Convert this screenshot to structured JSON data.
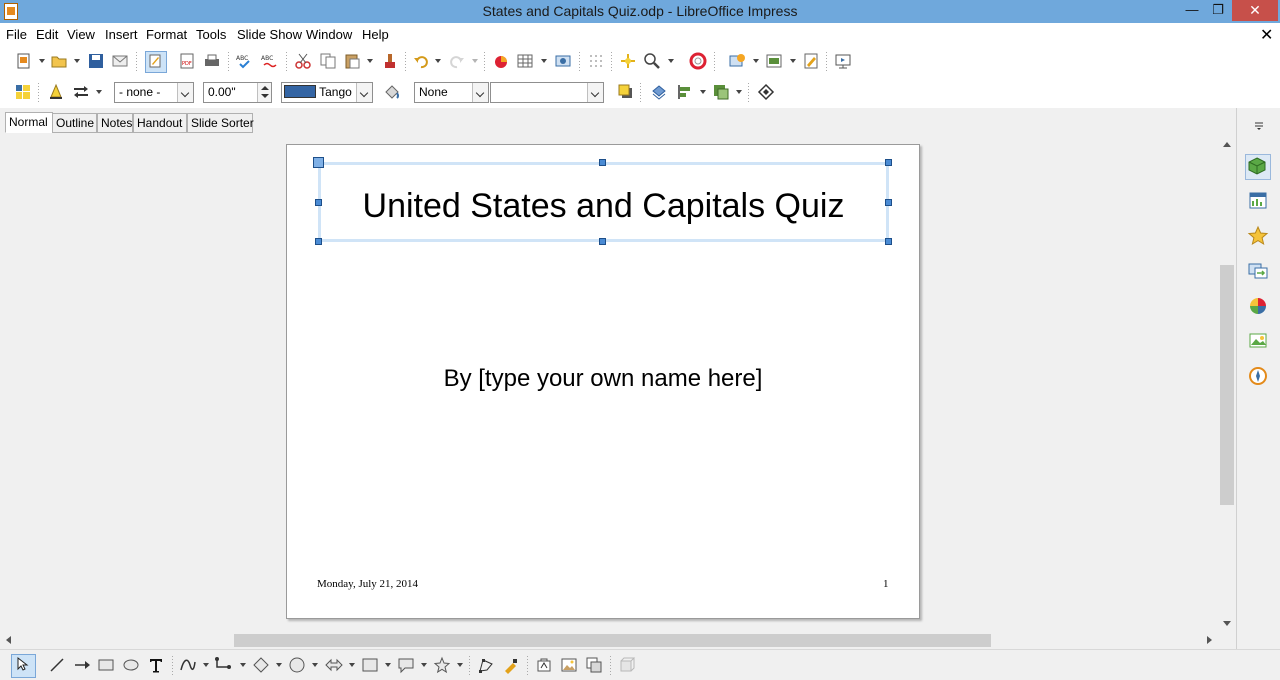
{
  "window": {
    "title": "States and Capitals Quiz.odp - LibreOffice Impress",
    "minimize_glyph": "—",
    "maximize_glyph": "❐",
    "close_glyph": "✕"
  },
  "menu": {
    "items": [
      "File",
      "Edit",
      "View",
      "Insert",
      "Format",
      "Tools",
      "Slide Show",
      "Window",
      "Help"
    ],
    "doc_close_glyph": "✕"
  },
  "toolbar_line": {
    "arrow_style": "- none -",
    "width_value": "0.00\"",
    "line_color": "Tango",
    "line_color_swatch": "#3465a4"
  },
  "toolbar_area": {
    "area_style": "None",
    "area_fill": ""
  },
  "tabs": [
    "Normal",
    "Outline",
    "Notes",
    "Handout",
    "Slide Sorter"
  ],
  "slide": {
    "title": "United States and Capitals Quiz",
    "subtitle": "By [type your own name here]",
    "footer_date": "Monday, July 21, 2014",
    "slide_number": "1"
  },
  "colors": {
    "titlebar": "#6fa8dc",
    "selection_frame": "#d0e4f7",
    "handle": "#4a8bd4"
  }
}
